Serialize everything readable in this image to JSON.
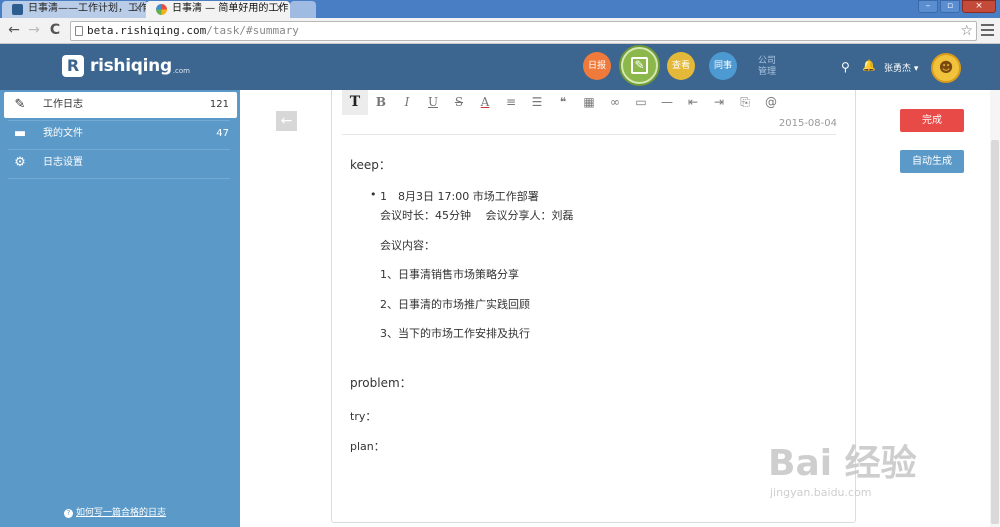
{
  "browser": {
    "tabs": [
      {
        "title": "日事清——工作计划，工作",
        "active": false
      },
      {
        "title": "日事清 — 简单好用的工作",
        "active": true
      }
    ],
    "tab_close": "×",
    "window_buttons": [
      "–",
      "▫",
      "×"
    ],
    "url_host": "beta.rishiqing.com",
    "url_path": "/task/#summary",
    "nav": {
      "back": "←",
      "forward": "→",
      "reload": "C"
    },
    "bookmark_star": "☆"
  },
  "header": {
    "logo_mark": "R",
    "brand": "rishiqing",
    "brand_suffix": ".com",
    "circles": {
      "daily": "日报",
      "write": "✎",
      "view": "查看",
      "same": "同事"
    },
    "mgmt": [
      "公司",
      "管理"
    ],
    "search_icon": "⚲",
    "bell_icon": "🔔",
    "user": "张勇杰 ▾",
    "avatar_icon": "☻"
  },
  "sidebar": {
    "items": [
      {
        "label": "工作日志",
        "count": "121",
        "icon": "✎",
        "active": true
      },
      {
        "label": "我的文件",
        "count": "47",
        "icon": "▬",
        "active": false
      },
      {
        "label": "日志设置",
        "count": "",
        "icon": "⚙",
        "active": false
      }
    ],
    "help": {
      "icon": "?",
      "text": "如何写一篇合格的日志"
    }
  },
  "editor": {
    "back_icon": "←",
    "toolbar": [
      "T",
      "B",
      "I",
      "U",
      "S",
      "A",
      "≡",
      "☰",
      "❝",
      "▦",
      "∞",
      "▭",
      "—",
      "⇤",
      "⇥",
      "⎘",
      "@"
    ],
    "date": "2015-08-04",
    "keep_label": "keep：",
    "bullet": "•",
    "item_title": "1　8月3日 17:00 市场工作部署",
    "item_meta": "会议时长：45分钟　 会议分享人：刘磊",
    "item_content_label": "会议内容：",
    "agenda": [
      "1、日事清销售市场策略分享",
      "2、日事清的市场推广实践回顾",
      "3、当下的市场工作安排及执行"
    ],
    "problem_label": "problem：",
    "try_label": "try：",
    "plan_label": "plan："
  },
  "actions": {
    "done": "完成",
    "auto": "自动生成"
  },
  "watermark": {
    "big": "Bai 经验",
    "small": "jingyan.baidu.com"
  }
}
